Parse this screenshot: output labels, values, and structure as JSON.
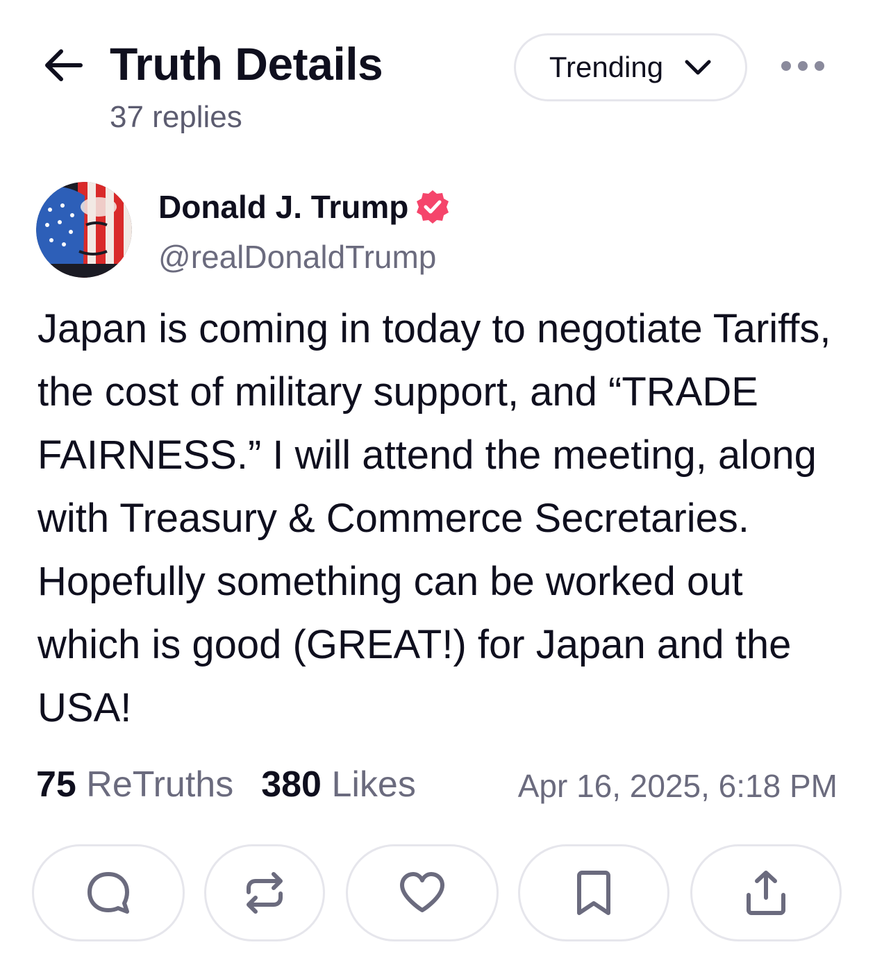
{
  "header": {
    "title": "Truth Details",
    "reply_count": "37 replies",
    "sort_label": "Trending",
    "back_icon": "arrow-left-icon",
    "more_icon": "ellipsis-icon"
  },
  "author": {
    "name": "Donald J. Trump",
    "handle": "@realDonaldTrump",
    "verified": true,
    "verified_color": "#f5456b"
  },
  "post": {
    "text": "Japan is coming in today to negotiate Tariffs, the cost of military support, and “TRADE FAIRNESS.” I will attend the meeting, along with Treasury & Commerce Secretaries. Hopefully something can be worked out which is good (GREAT!) for Japan and the USA!",
    "retruths_count": "75",
    "retruths_label": "ReTruths",
    "likes_count": "380",
    "likes_label": "Likes",
    "timestamp": "Apr 16, 2025, 6:18 PM"
  },
  "actions": [
    {
      "name": "reply",
      "icon": "chat-bubble-icon"
    },
    {
      "name": "retruth",
      "icon": "repeat-icon"
    },
    {
      "name": "like",
      "icon": "heart-icon"
    },
    {
      "name": "bookmark",
      "icon": "bookmark-icon"
    },
    {
      "name": "share",
      "icon": "share-icon"
    }
  ],
  "colors": {
    "text_primary": "#0f0f1e",
    "text_secondary": "#6b6b7e",
    "border": "#e6e6ec",
    "icon_gray": "#6b6b7e"
  }
}
